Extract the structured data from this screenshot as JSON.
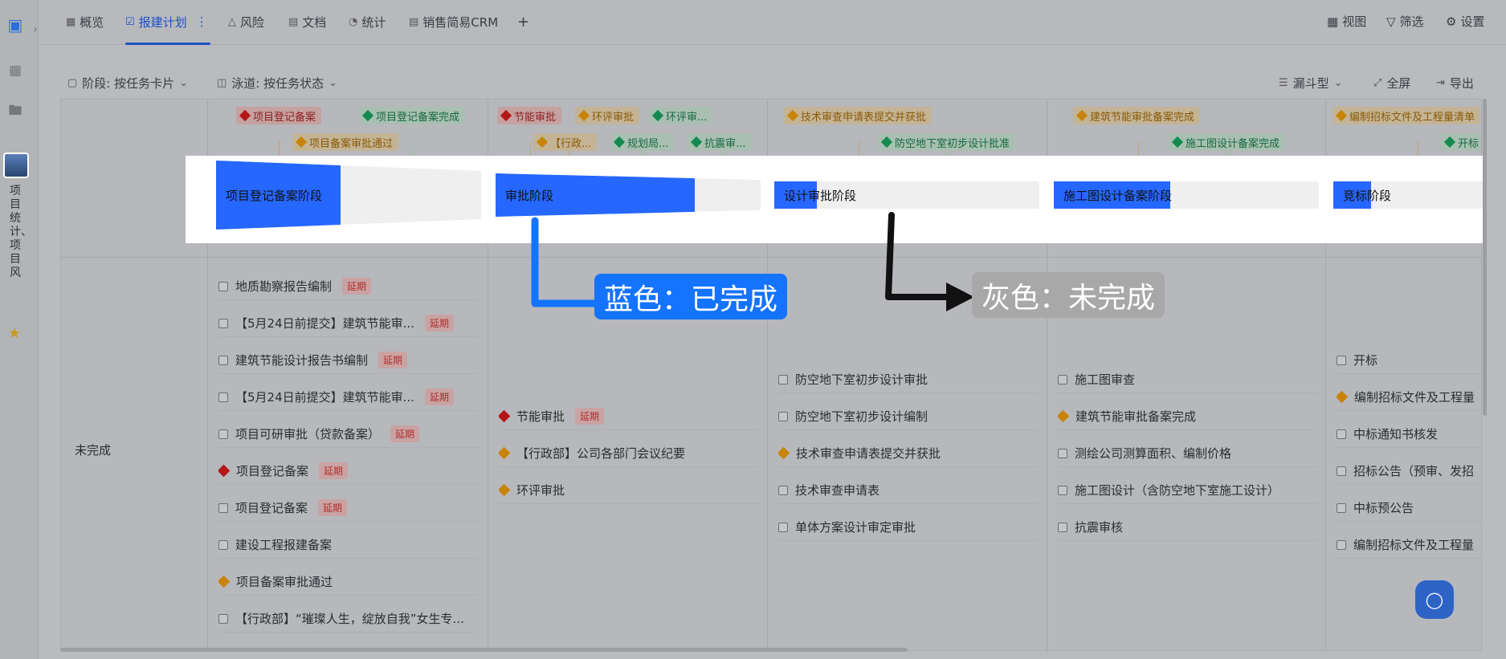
{
  "rail": {
    "vertical_text": "项目统计、项目风"
  },
  "topbar": {
    "tabs": [
      {
        "label": "概览"
      },
      {
        "label": "报建计划"
      },
      {
        "label": "风险"
      },
      {
        "label": "文档"
      },
      {
        "label": "统计"
      },
      {
        "label": "销售简易CRM"
      }
    ],
    "more": "⋮",
    "add": "+",
    "tools": [
      {
        "label": "视图"
      },
      {
        "label": "筛选"
      },
      {
        "label": "设置"
      }
    ]
  },
  "toolbar": {
    "stage": "阶段: 按任务卡片",
    "lane": "泳道: 按任务状态",
    "funnel": "漏斗型",
    "fullscreen": "全屏",
    "export": "导出"
  },
  "milestones": [
    {
      "label": "项目登记备案",
      "color": "red"
    },
    {
      "label": "项目登记备案完成",
      "color": "green"
    },
    {
      "label": "项目备案审批通过",
      "color": "orange"
    },
    {
      "label": "节能审批",
      "color": "red"
    },
    {
      "label": "环评审批",
      "color": "orange"
    },
    {
      "label": "环评审...",
      "color": "green"
    },
    {
      "label": "【行政...",
      "color": "orange"
    },
    {
      "label": "规划局...",
      "color": "green"
    },
    {
      "label": "抗震审...",
      "color": "green"
    },
    {
      "label": "技术审查申请表提交并获批",
      "color": "orange"
    },
    {
      "label": "防空地下室初步设计批准",
      "color": "green"
    },
    {
      "label": "建筑节能审批备案完成",
      "color": "orange"
    },
    {
      "label": "施工图设计备案完成",
      "color": "green"
    },
    {
      "label": "编制招标文件及工程量清单",
      "color": "orange"
    },
    {
      "label": "开标",
      "color": "green"
    }
  ],
  "phases": [
    {
      "label": "项目登记备案阶段",
      "progress": 0.47
    },
    {
      "label": "审批阶段",
      "progress": 0.75
    },
    {
      "label": "设计审批阶段",
      "progress": 0.16
    },
    {
      "label": "施工图设计备案阶段",
      "progress": 0.44
    },
    {
      "label": "竞标阶段",
      "progress": 0.25
    }
  ],
  "lane": {
    "label": "未完成"
  },
  "columns": [
    {
      "tasks": [
        {
          "label": "地质勘察报告编制",
          "kind": "checkbox",
          "late": "延期"
        },
        {
          "label": "【5月24日前提交】建筑节能审...",
          "kind": "checkbox",
          "late": "延期"
        },
        {
          "label": "建筑节能设计报告书编制",
          "kind": "checkbox",
          "late": "延期"
        },
        {
          "label": "【5月24日前提交】建筑节能审...",
          "kind": "checkbox",
          "late": "延期"
        },
        {
          "label": "项目可研审批（贷款备案）",
          "kind": "checkbox",
          "late": "延期"
        },
        {
          "label": "项目登记备案",
          "kind": "red",
          "late": "延期"
        },
        {
          "label": "项目登记备案",
          "kind": "checkbox",
          "late": "延期"
        },
        {
          "label": "建设工程报建备案",
          "kind": "checkbox",
          "late": ""
        },
        {
          "label": "项目备案审批通过",
          "kind": "orange",
          "late": ""
        },
        {
          "label": "【行政部】“璀璨人生，绽放自我”女生专...",
          "kind": "checkbox",
          "late": ""
        }
      ]
    },
    {
      "tasks": [
        {
          "label": "节能审批",
          "kind": "red",
          "late": "延期"
        },
        {
          "label": "【行政部】公司各部门会议纪要",
          "kind": "orange",
          "late": ""
        },
        {
          "label": "环评审批",
          "kind": "orange",
          "late": ""
        }
      ]
    },
    {
      "tasks": [
        {
          "label": "防空地下室初步设计审批",
          "kind": "checkbox",
          "late": ""
        },
        {
          "label": "防空地下室初步设计编制",
          "kind": "checkbox",
          "late": ""
        },
        {
          "label": "技术审查申请表提交并获批",
          "kind": "orange",
          "late": ""
        },
        {
          "label": "技术审查申请表",
          "kind": "checkbox",
          "late": ""
        },
        {
          "label": "单体方案设计审定审批",
          "kind": "checkbox",
          "late": ""
        }
      ]
    },
    {
      "tasks": [
        {
          "label": "施工图审查",
          "kind": "checkbox",
          "late": ""
        },
        {
          "label": "建筑节能审批备案完成",
          "kind": "orange",
          "late": ""
        },
        {
          "label": "测绘公司测算面积、编制价格",
          "kind": "checkbox",
          "late": ""
        },
        {
          "label": "施工图设计（含防空地下室施工设计）",
          "kind": "checkbox",
          "late": ""
        },
        {
          "label": "抗震审核",
          "kind": "checkbox",
          "late": ""
        }
      ]
    },
    {
      "tasks": [
        {
          "label": "开标",
          "kind": "checkbox",
          "late": ""
        },
        {
          "label": "编制招标文件及工程量",
          "kind": "orange",
          "late": ""
        },
        {
          "label": "中标通知书核发",
          "kind": "checkbox",
          "late": ""
        },
        {
          "label": "招标公告（预审、发招",
          "kind": "checkbox",
          "late": ""
        },
        {
          "label": "中标预公告",
          "kind": "checkbox",
          "late": ""
        },
        {
          "label": "编制招标文件及工程量",
          "kind": "checkbox",
          "late": ""
        }
      ]
    }
  ],
  "annotations": {
    "blue_label": "蓝色：已完成",
    "gray_label": "灰色：未完成",
    "blue_color": "#1473ff",
    "gray_color": "#a8a8a8"
  }
}
